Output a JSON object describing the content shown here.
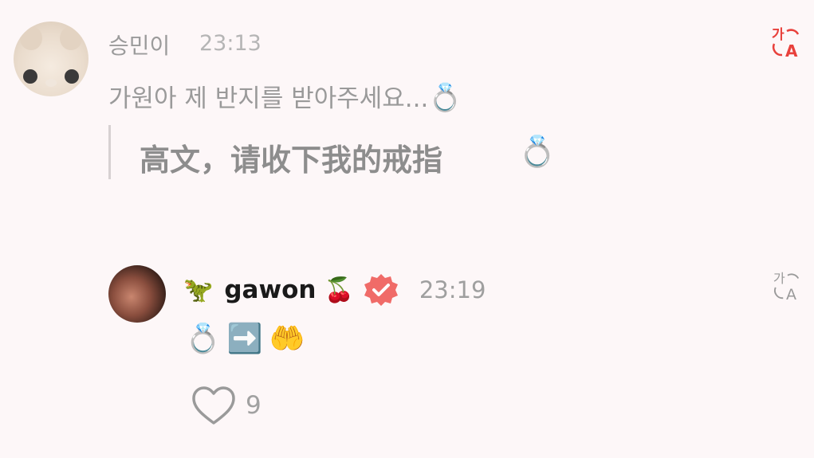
{
  "comment": {
    "author": "승민이",
    "time": "23:13",
    "text": "가원아 제 반지를 받아주세요...",
    "text_emoji": "💍",
    "translation": "高文，请收下我的戒指",
    "translation_emoji": "💍",
    "translate_icon": "translate-icon"
  },
  "reply": {
    "prefix_emoji": "🦖",
    "author": "gawon",
    "suffix_emoji": "🍒",
    "verified_icon": "verified-badge-icon",
    "time": "23:19",
    "body_emojis": [
      "💍",
      "➡️",
      "🤲"
    ],
    "like_count": "9",
    "translate_icon": "translate-icon"
  },
  "colors": {
    "background": "#fdf7f8",
    "accent_red": "#e8413c",
    "verified_badge": "#f06b68"
  }
}
